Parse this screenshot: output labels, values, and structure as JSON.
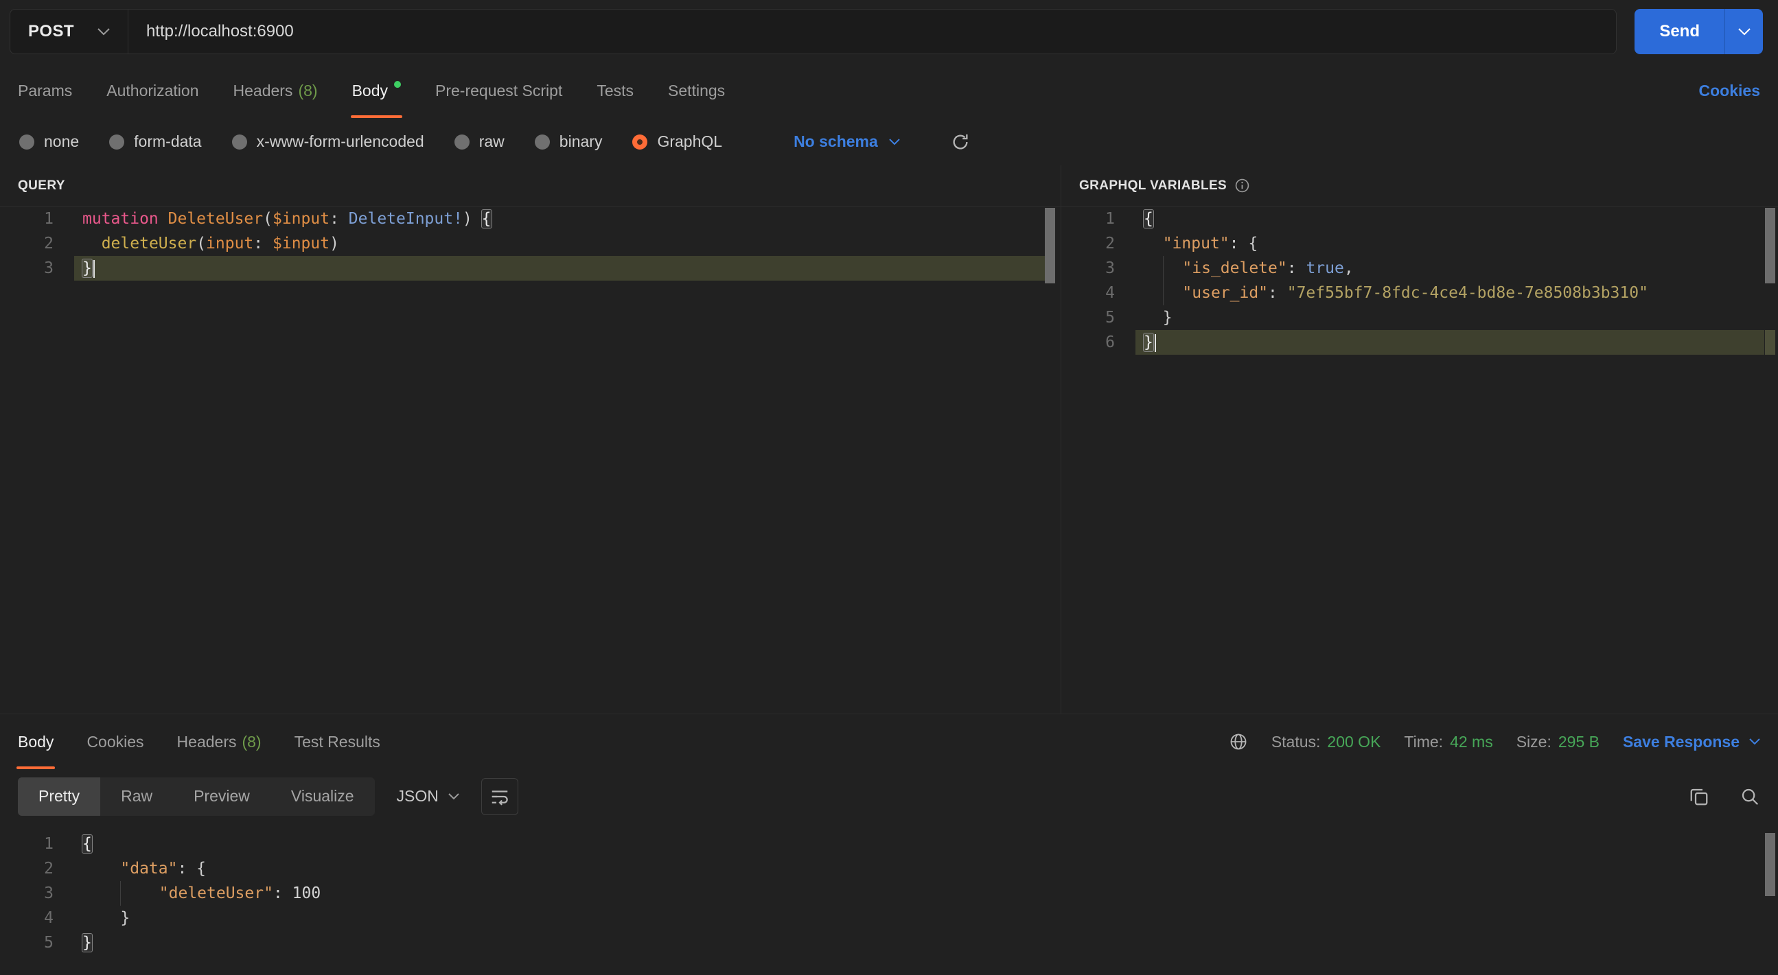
{
  "colors": {
    "accent": "#ff6c37",
    "link": "#3d7fe0",
    "success": "#47a758",
    "send_button": "#2c6bd9",
    "green_dot": "#3ecf63"
  },
  "request": {
    "method": "POST",
    "url": "http://localhost:6900",
    "send": "Send"
  },
  "tabs": {
    "params": "Params",
    "authorization": "Authorization",
    "headers": "Headers",
    "headers_count": "(8)",
    "body": "Body",
    "prerequest": "Pre-request Script",
    "tests": "Tests",
    "settings": "Settings",
    "cookies": "Cookies"
  },
  "body_types": {
    "none": "none",
    "form_data": "form-data",
    "urlencoded": "x-www-form-urlencoded",
    "raw": "raw",
    "binary": "binary",
    "graphql": "GraphQL",
    "schema": "No schema"
  },
  "query": {
    "title": "QUERY",
    "code": [
      {
        "n": "1",
        "tokens": [
          {
            "c": "kw",
            "t": "mutation"
          },
          {
            "c": "pl",
            "t": " "
          },
          {
            "c": "name",
            "t": "DeleteUser"
          },
          {
            "c": "pl",
            "t": "("
          },
          {
            "c": "var",
            "t": "$input"
          },
          {
            "c": "pl",
            "t": ": "
          },
          {
            "c": "type",
            "t": "DeleteInput!"
          },
          {
            "c": "pl",
            "t": ") "
          },
          {
            "c": "bm",
            "t": "{"
          }
        ]
      },
      {
        "n": "2",
        "tokens": [
          {
            "c": "pl",
            "t": "  "
          },
          {
            "c": "fn",
            "t": "deleteUser"
          },
          {
            "c": "pl",
            "t": "("
          },
          {
            "c": "var",
            "t": "input"
          },
          {
            "c": "pl",
            "t": ": "
          },
          {
            "c": "var",
            "t": "$input"
          },
          {
            "c": "pl",
            "t": ")"
          }
        ]
      },
      {
        "n": "3",
        "current": true,
        "cursor": true,
        "tokens": [
          {
            "c": "bm",
            "t": "}"
          }
        ]
      }
    ]
  },
  "variables": {
    "title": "GRAPHQL VARIABLES",
    "code": [
      {
        "n": "1",
        "tokens": [
          {
            "c": "bm",
            "t": "{"
          }
        ]
      },
      {
        "n": "2",
        "tokens": [
          {
            "c": "pl",
            "t": "  "
          },
          {
            "c": "key",
            "t": "\"input\""
          },
          {
            "c": "pl",
            "t": ": {"
          }
        ]
      },
      {
        "n": "3",
        "tokens": [
          {
            "c": "pl",
            "t": "  "
          },
          {
            "c": "guide",
            "t": ""
          },
          {
            "c": "pl",
            "t": "  "
          },
          {
            "c": "key",
            "t": "\"is_delete\""
          },
          {
            "c": "pl",
            "t": ": "
          },
          {
            "c": "bool",
            "t": "true"
          },
          {
            "c": "pl",
            "t": ","
          }
        ]
      },
      {
        "n": "4",
        "tokens": [
          {
            "c": "pl",
            "t": "  "
          },
          {
            "c": "guide",
            "t": ""
          },
          {
            "c": "pl",
            "t": "  "
          },
          {
            "c": "key",
            "t": "\"user_id\""
          },
          {
            "c": "pl",
            "t": ": "
          },
          {
            "c": "str",
            "t": "\"7ef55bf7-8fdc-4ce4-bd8e-7e8508b3b310\""
          }
        ]
      },
      {
        "n": "5",
        "tokens": [
          {
            "c": "pl",
            "t": "  }"
          }
        ]
      },
      {
        "n": "6",
        "current": true,
        "cursor": true,
        "tokens": [
          {
            "c": "bm",
            "t": "}"
          }
        ]
      }
    ]
  },
  "response": {
    "tab_body": "Body",
    "tab_cookies": "Cookies",
    "tab_headers": "Headers",
    "tab_headers_count": "(8)",
    "tab_tests": "Test Results",
    "status_label": "Status:",
    "status_value": "200 OK",
    "time_label": "Time:",
    "time_value": "42 ms",
    "size_label": "Size:",
    "size_value": "295 B",
    "save": "Save Response",
    "view_pretty": "Pretty",
    "view_raw": "Raw",
    "view_preview": "Preview",
    "view_visualize": "Visualize",
    "format": "JSON",
    "code": [
      {
        "n": "1",
        "tokens": [
          {
            "c": "bm",
            "t": "{"
          }
        ]
      },
      {
        "n": "2",
        "tokens": [
          {
            "c": "pl",
            "t": "    "
          },
          {
            "c": "key",
            "t": "\"data\""
          },
          {
            "c": "pl",
            "t": ": {"
          }
        ]
      },
      {
        "n": "3",
        "tokens": [
          {
            "c": "pl",
            "t": "    "
          },
          {
            "c": "guide",
            "t": ""
          },
          {
            "c": "pl",
            "t": "    "
          },
          {
            "c": "key",
            "t": "\"deleteUser\""
          },
          {
            "c": "pl",
            "t": ": "
          },
          {
            "c": "num",
            "t": "100"
          }
        ]
      },
      {
        "n": "4",
        "tokens": [
          {
            "c": "pl",
            "t": "    }"
          }
        ]
      },
      {
        "n": "5",
        "tokens": [
          {
            "c": "bm",
            "t": "}"
          }
        ]
      }
    ]
  }
}
